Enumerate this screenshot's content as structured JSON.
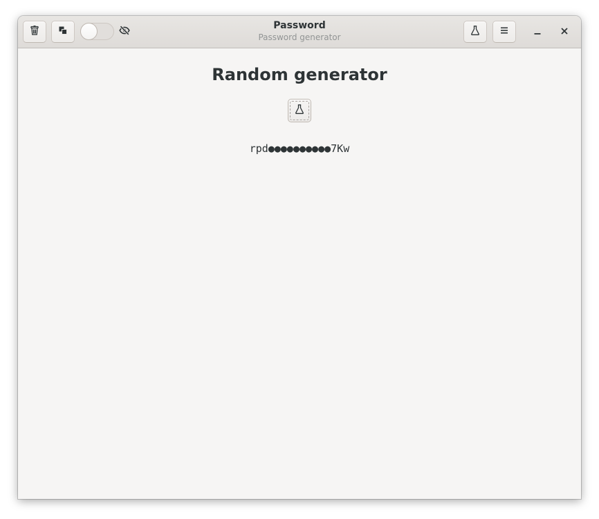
{
  "window": {
    "title": "Password",
    "subtitle": "Password generator"
  },
  "headerbar": {
    "left_buttons": [
      {
        "icon": "trash-icon"
      },
      {
        "icon": "copy-icon"
      }
    ],
    "toggle": {
      "state": "off"
    },
    "visibility_icon": "eye-off-icon",
    "right_buttons": [
      {
        "icon": "flask-icon"
      },
      {
        "icon": "hamburger-menu-icon"
      }
    ],
    "window_controls": {
      "minimize_icon": "minimize-icon",
      "close_icon": "close-icon"
    }
  },
  "main": {
    "heading": "Random generator",
    "generate_button": {
      "icon": "flask-icon"
    },
    "password": "rpd●●●●●●●●●●7Kw"
  },
  "colors": {
    "text": "#2e3436",
    "window_bg": "#f6f5f4",
    "headerbar_bg": "#e3e0dd",
    "subtitle": "#929595"
  }
}
